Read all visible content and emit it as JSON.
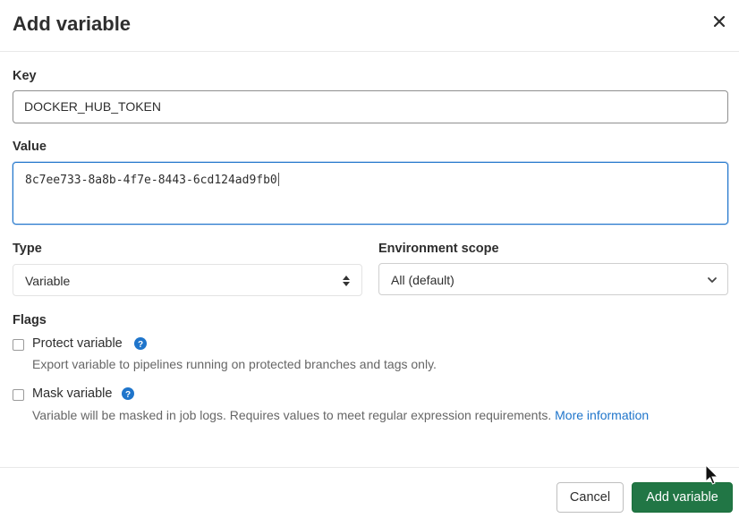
{
  "modal": {
    "title": "Add variable"
  },
  "form": {
    "key_label": "Key",
    "key_value": "DOCKER_HUB_TOKEN",
    "value_label": "Value",
    "value_value": "8c7ee733-8a8b-4f7e-8443-6cd124ad9fb0",
    "type_label": "Type",
    "type_selected": "Variable",
    "env_label": "Environment scope",
    "env_selected": "All (default)",
    "flags_label": "Flags",
    "protect": {
      "label": "Protect variable",
      "help": "Export variable to pipelines running on protected branches and tags only.",
      "checked": false
    },
    "mask": {
      "label": "Mask variable",
      "help": "Variable will be masked in job logs. Requires values to meet regular expression requirements.",
      "link": "More information",
      "checked": false
    }
  },
  "footer": {
    "cancel_label": "Cancel",
    "add_label": "Add variable"
  },
  "colors": {
    "primary_green": "#217645",
    "link_blue": "#1f75cb",
    "focus_blue": "#1f75cb"
  },
  "icons": {
    "close": "close-icon",
    "help": "question-circle-icon",
    "select_arrows": "sort-arrows-icon",
    "chevron": "chevron-down-icon",
    "cursor": "mouse-pointer-icon"
  }
}
